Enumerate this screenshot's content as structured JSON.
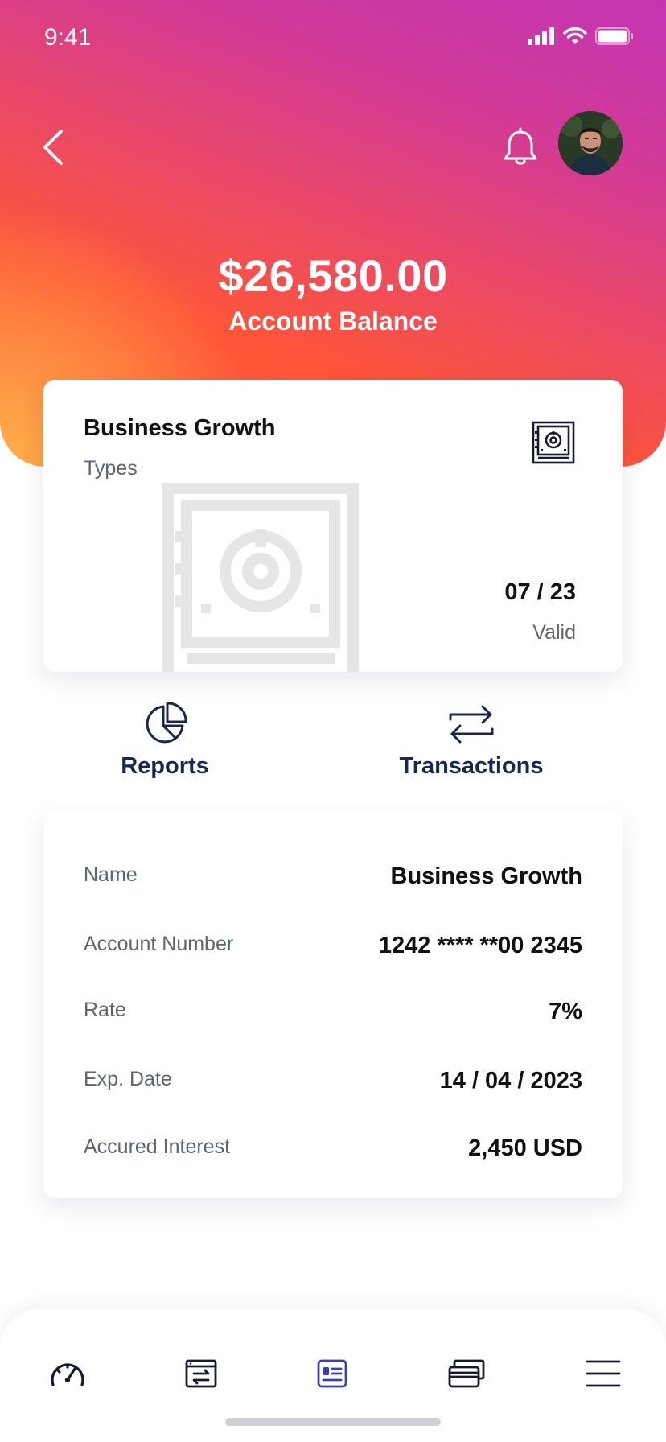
{
  "status_bar": {
    "time": "9:41"
  },
  "header": {
    "balance_amount": "$26,580.00",
    "balance_label": "Account Balance"
  },
  "account_card": {
    "title": "Business Growth",
    "subtitle": "Types",
    "valid_date": "07 / 23",
    "valid_label": "Valid"
  },
  "actions": {
    "reports_label": "Reports",
    "transactions_label": "Transactions"
  },
  "details": {
    "rows": [
      {
        "label": "Name",
        "value": "Business Growth"
      },
      {
        "label": "Account Number",
        "value": "1242 **** **00 2345"
      },
      {
        "label": "Rate",
        "value": "7%"
      },
      {
        "label": "Exp. Date",
        "value": "14 / 04 / 2023"
      },
      {
        "label": "Accured Interest",
        "value": "2,450 USD"
      }
    ]
  },
  "tab_bar": {
    "tabs": [
      {
        "icon": "speedometer-icon",
        "active": false
      },
      {
        "icon": "transfer-window-icon",
        "active": false
      },
      {
        "icon": "account-details-icon",
        "active": true
      },
      {
        "icon": "cards-icon",
        "active": false
      },
      {
        "icon": "menu-icon",
        "active": false
      }
    ]
  },
  "colors": {
    "gradient_pink": "#c435b3",
    "gradient_red": "#ff5538",
    "gradient_orange": "#ffb04a",
    "navy": "#1b2650",
    "active_tab": "#3a3fb8"
  }
}
